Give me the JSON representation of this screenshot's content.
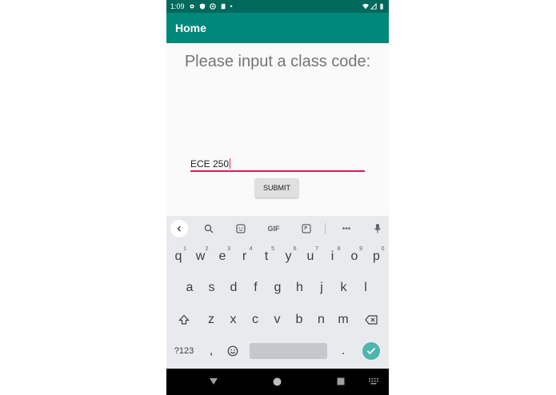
{
  "status_bar": {
    "time": "1:09",
    "dot": "•"
  },
  "app_bar": {
    "title": "Home"
  },
  "main": {
    "prompt": "Please input a class code:",
    "class_code_value": "ECE 250",
    "submit_label": "SUBMIT"
  },
  "keyboard": {
    "toolbar": {
      "gif_label": "GIF",
      "more_label": "•••"
    },
    "row1": [
      {
        "key": "q",
        "hint": "1"
      },
      {
        "key": "w",
        "hint": "2"
      },
      {
        "key": "e",
        "hint": "3"
      },
      {
        "key": "r",
        "hint": "4"
      },
      {
        "key": "t",
        "hint": "5"
      },
      {
        "key": "y",
        "hint": "6"
      },
      {
        "key": "u",
        "hint": "7"
      },
      {
        "key": "i",
        "hint": "8"
      },
      {
        "key": "o",
        "hint": "9"
      },
      {
        "key": "p",
        "hint": "0"
      }
    ],
    "row2": [
      "a",
      "s",
      "d",
      "f",
      "g",
      "h",
      "j",
      "k",
      "l"
    ],
    "row3": [
      "z",
      "x",
      "c",
      "v",
      "b",
      "n",
      "m"
    ],
    "symbols_label": "?123",
    "comma": ",",
    "period": "."
  },
  "colors": {
    "status_bar": "#00695c",
    "app_bar": "#00897b",
    "input_underline": "#d81b60",
    "enter_key": "#4db6ac"
  }
}
